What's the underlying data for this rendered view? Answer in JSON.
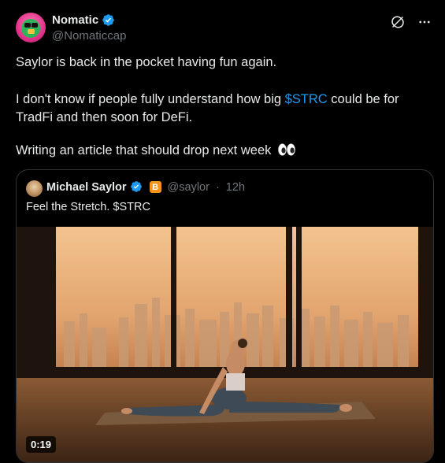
{
  "author": {
    "display_name": "Nomatic",
    "handle": "@Nomaticcap"
  },
  "tweet": {
    "line1": "Saylor is back in the pocket having fun again.",
    "line2_pre": "I don't know if people fully understand how big ",
    "line2_cashtag": "$STRC",
    "line2_post": " could be for",
    "line3": "TradFi and then soon for DeFi.",
    "line4": "Writing an article that should drop next week"
  },
  "quote": {
    "display_name": "Michael Saylor",
    "badge": "B",
    "handle": "@saylor",
    "separator": "·",
    "time": "12h",
    "text": "Feel the Stretch. $STRC",
    "video_duration": "0:19"
  },
  "colors": {
    "background": "#000000",
    "text": "#e7e9ea",
    "muted": "#71767b",
    "accent": "#1d9bf0",
    "verified": "#1d9bf0",
    "btc_badge": "#f7931a"
  },
  "icons": [
    "grok-icon",
    "more-icon",
    "verified-badge-icon",
    "eyes-emoji-icon"
  ]
}
